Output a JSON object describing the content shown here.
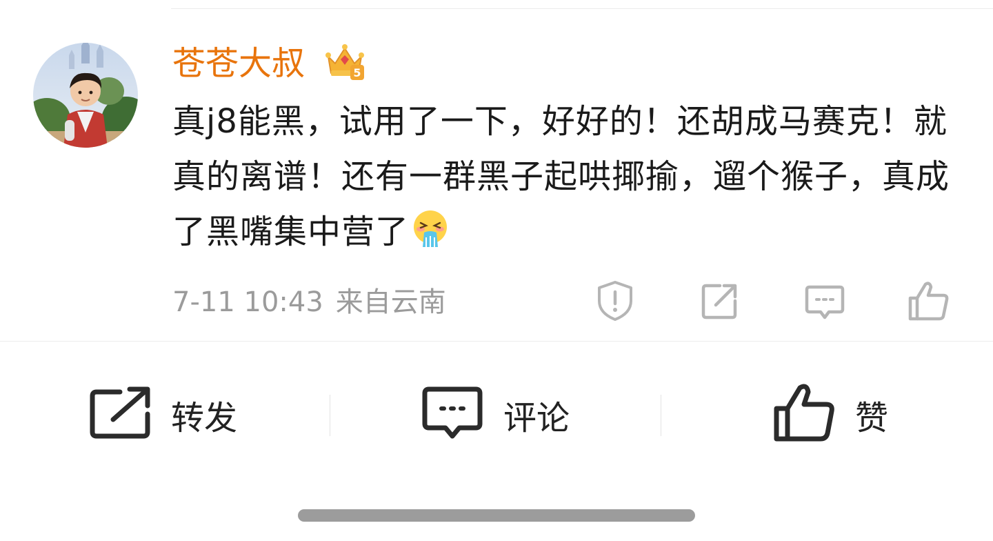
{
  "comment": {
    "author": "苍苍大叔",
    "badge_icon": "crown-level-5-icon",
    "badge_level": "5",
    "text": "真j8能黑，试用了一下，好好的！还胡成马赛克！就真的离谱！还有一群黑子起哄揶揄，遛个猴子，真成了黑嘴集中营了",
    "emoji": "vomit-emoji",
    "time": "7-11 10:43",
    "location": "来自云南",
    "row_icons": [
      "report-icon",
      "share-icon",
      "comment-icon",
      "like-icon"
    ]
  },
  "actions": {
    "repost_label": "转发",
    "comment_label": "评论",
    "like_label": "赞"
  },
  "colors": {
    "username": "#e8740c",
    "text": "#1a1a1a",
    "meta": "#9b9b9b",
    "icon": "#b5b5b5",
    "action_icon": "#2b2b2b"
  }
}
